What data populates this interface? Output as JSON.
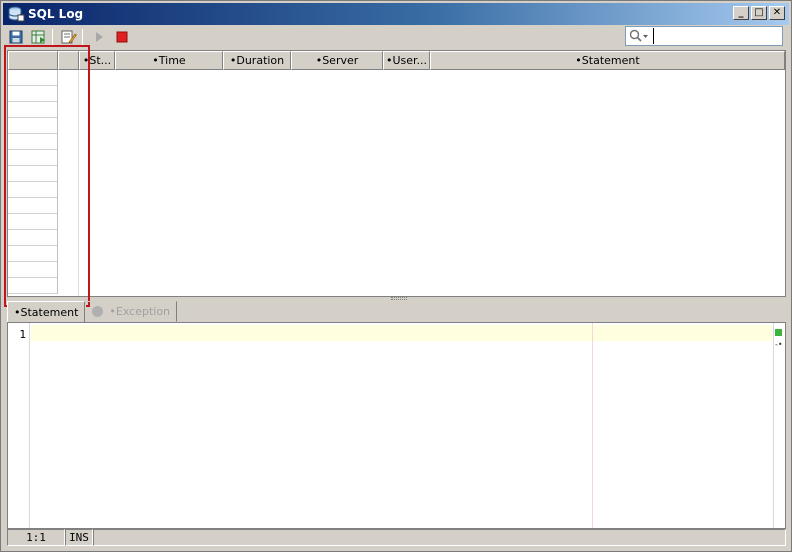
{
  "window": {
    "title": "SQL Log",
    "minimize_label": "_",
    "maximize_label": "□",
    "close_label": "✕"
  },
  "toolbar": {
    "buttons": [
      {
        "name": "save-icon"
      },
      {
        "name": "export-icon"
      },
      {
        "name": "edit-icon"
      },
      {
        "name": "play-icon"
      },
      {
        "name": "stop-icon"
      }
    ],
    "search": {
      "value": "",
      "placeholder": ""
    }
  },
  "grid": {
    "columns": [
      {
        "label": ""
      },
      {
        "label": ""
      },
      {
        "label": "St..."
      },
      {
        "label": "Time"
      },
      {
        "label": "Duration"
      },
      {
        "label": "Server"
      },
      {
        "label": "User..."
      },
      {
        "label": "Statement"
      }
    ],
    "row_count": 14
  },
  "tabs": [
    {
      "label": "Statement",
      "active": true
    },
    {
      "label": "Exception",
      "active": false
    }
  ],
  "editor": {
    "line_number": "1"
  },
  "status": {
    "position": "1:1",
    "mode": "INS",
    "message": ""
  },
  "colors": {
    "highlight_box": "#c0151b",
    "current_line": "#ffffe0",
    "ok_mark": "#3cb43c"
  }
}
